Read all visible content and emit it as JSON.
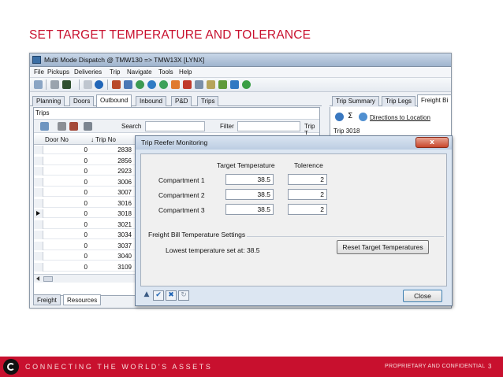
{
  "slide": {
    "title": "SET TARGET TEMPERATURE AND TOLERANCE"
  },
  "app": {
    "window_title": "Multi Mode Dispatch @ TMW130 => TMW13X [LYNX]",
    "menu": [
      "File",
      "Pickups",
      "Deliveries",
      "Trip",
      "Navigate",
      "Tools",
      "Help"
    ],
    "tabs_left": [
      "Planning",
      "Doors",
      "Outbound",
      "Inbound",
      "P&D",
      "Trips"
    ],
    "active_tab_left": "Outbound",
    "trips_caption": "Trips",
    "search_label": "Search",
    "filter_label": "Filter",
    "trip_label_cut": "Trip T",
    "columns": [
      "Door No",
      "Trip No"
    ],
    "rows": [
      {
        "door": "0",
        "trip": "2838"
      },
      {
        "door": "0",
        "trip": "2856"
      },
      {
        "door": "0",
        "trip": "2923"
      },
      {
        "door": "0",
        "trip": "3006"
      },
      {
        "door": "0",
        "trip": "3007"
      },
      {
        "door": "0",
        "trip": "3016"
      },
      {
        "door": "0",
        "trip": "3018"
      },
      {
        "door": "0",
        "trip": "3021"
      },
      {
        "door": "0",
        "trip": "3034"
      },
      {
        "door": "0",
        "trip": "3037"
      },
      {
        "door": "0",
        "trip": "3040"
      },
      {
        "door": "0",
        "trip": "3109"
      }
    ],
    "selected_row": 6,
    "bottom_tabs": [
      "Freight",
      "Resources"
    ],
    "active_bottom_tab": "Resources",
    "tabs_right": [
      "Trip Summary",
      "Trip Legs",
      "Freight Bi"
    ],
    "active_tab_right": "Freight Bi",
    "directions_link": "Directions to Location",
    "trip_field": "Trip  3018"
  },
  "dialog": {
    "title": "Trip Reefer Monitoring",
    "close_glyph": "x",
    "col_target": "Target Temperature",
    "col_tolerance": "Tolerence",
    "compartments": [
      {
        "label": "Compartment 1",
        "target": "38.5",
        "tolerance": "2"
      },
      {
        "label": "Compartment 2",
        "target": "38.5",
        "tolerance": "2"
      },
      {
        "label": "Compartment 3",
        "target": "38.5",
        "tolerance": "2"
      }
    ],
    "group_title": "Freight Bill Temperature Settings",
    "lowest_text": "Lowest temperature set at:  38.5",
    "reset_button": "Reset Target Temperatures",
    "close_button": "Close"
  },
  "footer": {
    "tagline": "CONNECTING THE WORLD'S ASSETS",
    "confidential": "PROPRIETARY AND CONFIDENTIAL",
    "page_number": "3"
  },
  "colors": {
    "brand_red": "#c8102e",
    "title_red": "#c8102e"
  }
}
